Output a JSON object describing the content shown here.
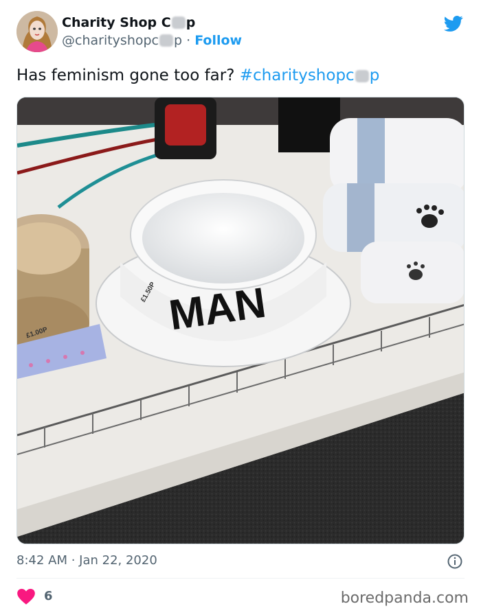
{
  "tweet": {
    "display_name_start": "Charity Shop C",
    "display_name_end": "p",
    "handle_start": "@charityshopc",
    "handle_end": "p",
    "separator": " · ",
    "follow_label": "Follow",
    "text": "Has feminism gone too far? ",
    "hashtag_start": "#charityshopc",
    "hashtag_end": "p",
    "timestamp": "8:42 AM · Jan 22, 2020",
    "like_count": "6"
  },
  "photo": {
    "bowl_label": "MAN",
    "price_tag_left": "£1.00P",
    "price_tag_bowl": "£1.50P"
  },
  "watermark": "boredpanda.com",
  "icons": {
    "platform": "twitter-bird-icon",
    "info": "info-icon",
    "like": "heart-icon"
  },
  "colors": {
    "accent": "#1d9bf0",
    "like": "#f91880",
    "muted": "#536471"
  }
}
